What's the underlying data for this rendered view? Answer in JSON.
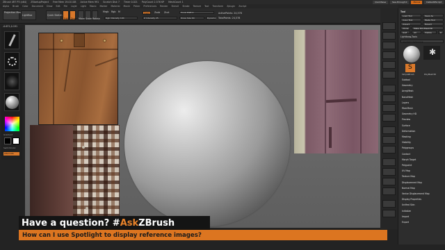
{
  "titlebar": {
    "items": [
      "ZBrush 4R7 P3 (x64)",
      "ZStartupProject",
      "Free Mem 19.011GB",
      "Active Mem 991",
      "Scratch Disk 7",
      "Timer 0.021",
      "PolyCount 2.576 KP",
      "MeshCount 1"
    ],
    "buttons": [
      "QuickSave",
      "See-through 0",
      "Menus",
      "DefaultZScript"
    ]
  },
  "menubar": [
    "Alpha",
    "Brush",
    "Color",
    "Document",
    "Draw",
    "Edit",
    "File",
    "Layer",
    "Light",
    "Macro",
    "Marker",
    "Material",
    "Movie",
    "Picker",
    "Preferences",
    "Render",
    "Stencil",
    "Stroke",
    "Texture",
    "Tool",
    "Transform",
    "Zplugin",
    "Zscript"
  ],
  "shelf": {
    "projection_master": "Projection Master",
    "lightbox": "LightBox",
    "quick_sketch": "Quick Sketch",
    "edit": "Edit",
    "draw": "Draw",
    "move": "Move",
    "scale": "Scale",
    "rotate": "Rotate",
    "mrgb": "Mrgb",
    "rgb": "Rgb",
    "m": "M",
    "zadd": "Zadd",
    "zsub": "Zsub",
    "zcut": "Zcut",
    "rgb_intensity": "Rgb Intensity 100",
    "z_intensity": "Z Intensity 25",
    "focal_shift": "Focal Shift 0",
    "draw_size": "Draw Size 64",
    "dynamic": "Dynamic",
    "active_points": "ActivePoints: 24,578",
    "total_points": "TotalPoints: 24,578"
  },
  "coords": "-0.671,0.191",
  "left_tray": {
    "labels": [
      "Gradient",
      "SwitchColor",
      "Alternate"
    ]
  },
  "right_panel": {
    "tool_title": "Tool",
    "buttons": [
      "Load Tool",
      "Save As",
      "Copy Tool",
      "Paste Tool",
      "Import",
      "Export",
      "Clone",
      "Make PolyMesh3D",
      "GoZ",
      "All",
      "Visible",
      "R"
    ],
    "lightbox_tools": "Lightbox►Tools",
    "spotlight_label": "Spotlight Reference",
    "subtools": [
      "SimpleBrush",
      "PolyMesh3D"
    ],
    "menus": [
      "Subtool",
      "Geometry",
      "ArrayMesh",
      "NanoMesh",
      "Layers",
      "FiberMesh",
      "Geometry HD",
      "Preview",
      "Surface",
      "Deformation",
      "Masking",
      "Visibility",
      "Polygroups",
      "Contact",
      "Morph Target",
      "Polypaint",
      "UV Map",
      "Texture Map",
      "Displacement Map",
      "Normal Map",
      "Vector Displacement Map",
      "Display Properties",
      "Unified Skin",
      "Initialize",
      "Import",
      "Export"
    ]
  },
  "banner": {
    "question_prefix": "Have a question? #",
    "ask": "Ask",
    "zbrush": "ZBrush",
    "subtitle": "How can I use Spotlight to display reference images?"
  },
  "colors": {
    "accent_orange": "#dc7520",
    "banner_dark": "#141414",
    "canvas_gray": "#6a6a6a"
  }
}
